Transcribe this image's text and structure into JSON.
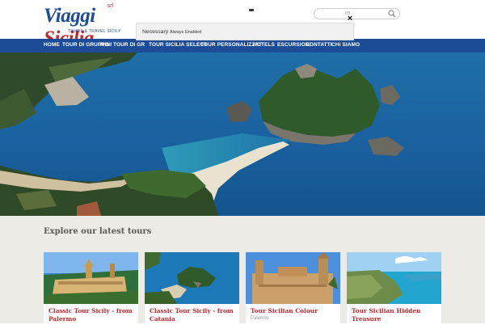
{
  "header": {
    "logo": {
      "text_a": "Viaggi",
      "text_b": "Sicilia",
      "tagline": "TOURS & TRAVEL SICILY",
      "mark": "srl"
    },
    "search": {
      "placeholder": "re"
    }
  },
  "nav": {
    "items": [
      {
        "label": "HOME"
      },
      {
        "label": "TOUR DI GRUPPO"
      },
      {
        "label": "MINI TOUR DI GR"
      },
      {
        "label": "TOUR SICILIA SELECT"
      },
      {
        "label": "TOUR PERSONALIZZATI"
      },
      {
        "label": "HOTELS"
      },
      {
        "label": "ESCURSIONI"
      },
      {
        "label": "CONTATTI"
      },
      {
        "label": "CHI SIAMO"
      }
    ]
  },
  "cookie": {
    "label": "Necessary",
    "status": "Always Enabled",
    "close": "×"
  },
  "tours": {
    "heading": "Explore our latest tours",
    "cards": [
      {
        "title": "Classic Tour Sicily - from Palermo",
        "subtitle": ""
      },
      {
        "title": "Classic Tour Sicily - from Catania",
        "subtitle": ""
      },
      {
        "title": "Tour Sicilian Colour",
        "subtitle": "Palermo"
      },
      {
        "title": "Tour Sicilian Hidden Treasure",
        "subtitle": ""
      }
    ]
  },
  "colors": {
    "brand_blue": "#1d4c97",
    "brand_red": "#c0282d",
    "section_bg": "#ecebe6"
  },
  "icons": {
    "search": "search-icon",
    "close": "close-icon"
  }
}
